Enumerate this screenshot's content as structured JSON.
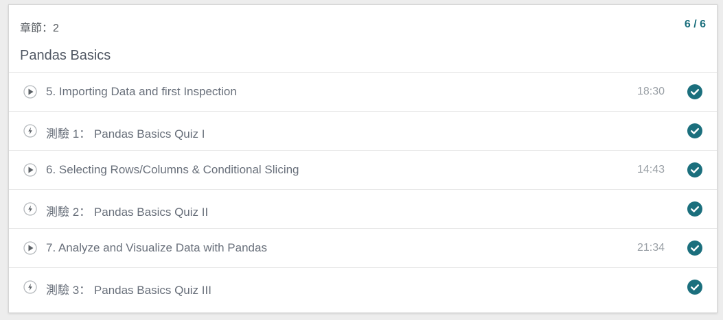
{
  "section": {
    "label": "章節：2",
    "progress": "6 / 6",
    "title": "Pandas Basics"
  },
  "items": [
    {
      "type": "video",
      "icon": "play-circle-icon",
      "title": "5. Importing Data and first Inspection",
      "duration": "18:30",
      "completed": true
    },
    {
      "type": "quiz",
      "icon": "lightning-circle-icon",
      "title": "測驗 1： Pandas Basics Quiz I",
      "duration": "",
      "completed": true
    },
    {
      "type": "video",
      "icon": "play-circle-icon",
      "title": "6. Selecting Rows/Columns & Conditional Slicing",
      "duration": "14:43",
      "completed": true
    },
    {
      "type": "quiz",
      "icon": "lightning-circle-icon",
      "title": "測驗 2： Pandas Basics Quiz II",
      "duration": "",
      "completed": true
    },
    {
      "type": "video",
      "icon": "play-circle-icon",
      "title": "7. Analyze and Visualize Data with Pandas",
      "duration": "21:34",
      "completed": true
    },
    {
      "type": "quiz",
      "icon": "lightning-circle-icon",
      "title": "測驗 3： Pandas Basics Quiz III",
      "duration": "",
      "completed": true
    }
  ],
  "colors": {
    "accent": "#1b6f7d",
    "text": "#686f7a",
    "muted": "#9aa0a6"
  }
}
